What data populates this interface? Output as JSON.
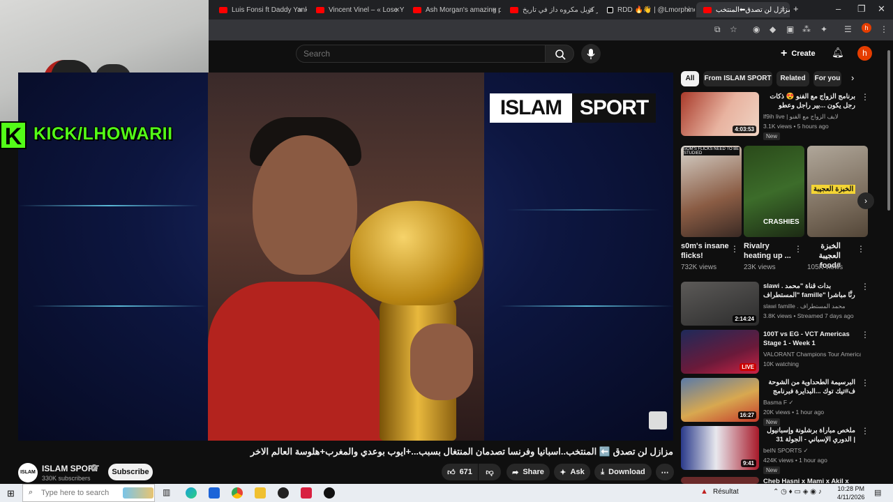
{
  "browser": {
    "tabs": [
      {
        "label": "Luis Fonsi ft Daddy Yanke",
        "icon": "youtube-icon"
      },
      {
        "label": "Vincent Vinel – « Lose You",
        "icon": "youtube-icon"
      },
      {
        "label": "Ash Morgan's amazing pe",
        "icon": "youtube-icon"
      },
      {
        "label": "أكثر كويل مكروه داز في تاريخ",
        "icon": "youtube-icon"
      },
      {
        "label": "RDD 🔥👋 | @Lmorphine",
        "icon": "tiktok-icon"
      },
      {
        "label": "مزازل لن تصدق⬅المنتخب",
        "icon": "youtube-icon"
      }
    ],
    "new_tab": "+"
  },
  "header": {
    "search_placeholder": "Search",
    "create_label": "Create",
    "avatar_letter": "h"
  },
  "webcam": {
    "kick_letter": "K",
    "kick_text": "KICK/LHOWARII"
  },
  "player": {
    "brand_left": "ISLAM",
    "brand_right": "SPORT"
  },
  "video": {
    "title": "مزازل لن تصدق ⬅️ المنتخب..اسبانيا وفرنسا تصدمان المنتغال بسبب...+ايوب بوعدي والمغرب+هلوسة العالم الاخر",
    "channel": {
      "name": "ISLAM SPORT",
      "avatar_text": "ISLAM SPORT",
      "subscribers": "330K subscribers",
      "subscribe_label": "Subscribe"
    },
    "actions": {
      "likes": "671",
      "share": "Share",
      "ask": "Ask",
      "download": "Download"
    }
  },
  "sidebar": {
    "chips": [
      "All",
      "From ISLAM SPORT",
      "Related",
      "For you"
    ],
    "videos_top": [
      {
        "title": "برنامج الزواج مع الفنو 😍 ذكات رجل يكون ...بير راجل وعطو الراهش مفهم فيدة#الموت",
        "channel": "lf9ih live | لايف الزواج مع الفنو",
        "meta": "3.1K views • 5 hours ago",
        "badge": "New",
        "duration": "4:03:53",
        "rtl": true
      }
    ],
    "shorts": [
      {
        "title": "s0m's insane flicks!",
        "views": "732K views",
        "rtl": false,
        "overlay": "SOM'S FLICKS NEED TO BE STUDIED"
      },
      {
        "title": "Rivalry heating up ...",
        "views": "23K views",
        "rtl": false,
        "overlay": "CRASHIES"
      },
      {
        "title": "الخبزة العجيبة #food",
        "views": "105K views",
        "rtl": true,
        "overlay": "الخبزة العجيبة"
      }
    ],
    "videos": [
      {
        "title": "slawi . بدات قناة \"محمد المستطراف\" famille\" رنَّا مباشرا حاليا مرحبا بالكل\"",
        "channel": "slawi famille . محمد المستطراف",
        "meta": "3.8K views • Streamed 7 days ago",
        "badge": "",
        "duration": "2:14:24",
        "rtl": false
      },
      {
        "title": "100T vs EG - VCT Americas Stage 1 - Week 1",
        "channel": "VALORANT Champions Tour Americas ✓",
        "meta": "10K watching",
        "badge": "",
        "duration": "LIVE",
        "rtl": false
      },
      {
        "title": "البرسيمة الطحداوية من الشوحة ف#تيك توك ...البدايرة فبرنامج لالة العروسة وكوبل",
        "channel": "Basma F ✓",
        "meta": "20K views • 1 hour ago",
        "badge": "New",
        "duration": "16:27",
        "rtl": true
      },
      {
        "title": "ملخص مباراة برشلونة وإسبانيول | الدوري الإسباني - الجولة 31",
        "channel": "beIN SPORTS ✓",
        "meta": "424K views • 1 hour ago",
        "badge": "New",
        "duration": "9:41",
        "rtl": true
      },
      {
        "title": "Cheb Hasni x Mami x Akil x",
        "channel": "",
        "meta": "",
        "badge": "",
        "duration": "",
        "rtl": false
      }
    ]
  },
  "taskbar": {
    "search_placeholder": "Type here to search",
    "weather": "Résultat",
    "time": "10:28 PM",
    "date": "4/11/2026"
  }
}
